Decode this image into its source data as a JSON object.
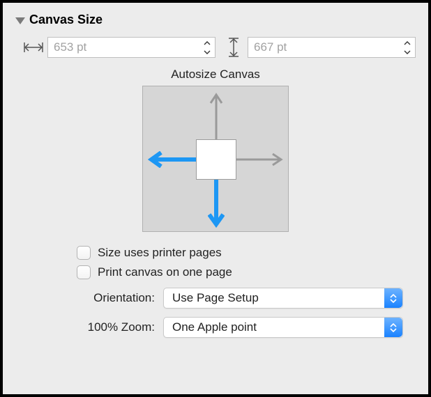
{
  "section": {
    "title": "Canvas Size"
  },
  "width": {
    "value": "653 pt"
  },
  "height": {
    "value": "667 pt"
  },
  "autosize": {
    "label": "Autosize Canvas"
  },
  "checks": {
    "printer_pages": "Size uses printer pages",
    "one_page": "Print canvas on one page"
  },
  "orientation": {
    "label": "Orientation:",
    "value": "Use Page Setup"
  },
  "zoom": {
    "label": "100% Zoom:",
    "value": "One Apple point"
  }
}
